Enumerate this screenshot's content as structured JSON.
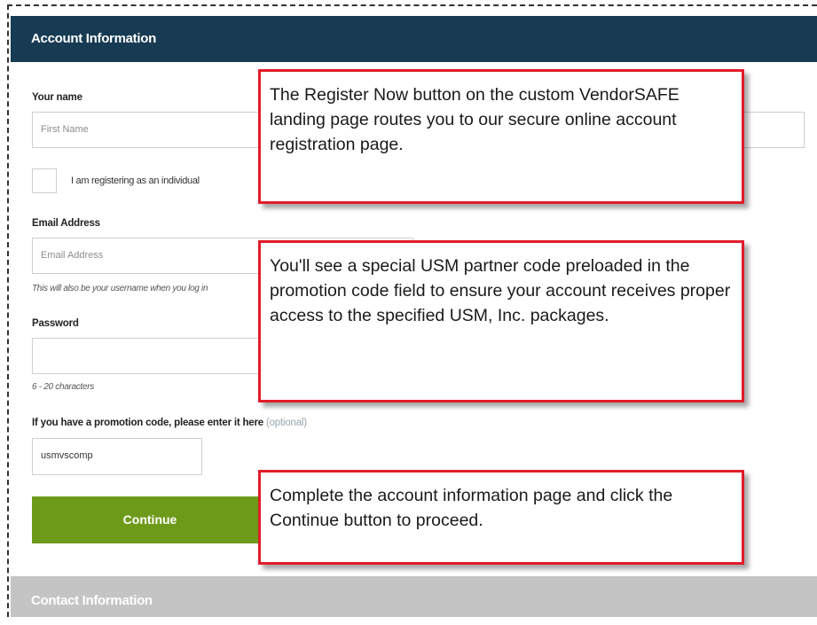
{
  "account_section": {
    "title": "Account Information"
  },
  "name": {
    "label": "Your name",
    "first_placeholder": "First Name",
    "last_placeholder": ""
  },
  "individual": {
    "label": "I am registering as an individual"
  },
  "email": {
    "label": "Email Address",
    "placeholder": "Email Address",
    "hint": "This will also be your username when you log in"
  },
  "password": {
    "label": "Password",
    "value": "",
    "hint": "6 - 20 characters"
  },
  "promo": {
    "label": "If you have a promotion code, please enter it here",
    "optional": "(optional)",
    "value": "usmvscomp"
  },
  "continue_button": {
    "label": "Continue"
  },
  "contact_section": {
    "title": "Contact Information"
  },
  "callouts": [
    {
      "text": "The Register Now button on the custom VendorSAFE landing page routes you to our secure online account registration page."
    },
    {
      "text": "You'll see a special USM partner code preloaded in the promotion code field to ensure your account receives proper access to the specified USM, Inc. packages."
    },
    {
      "text": "Complete the account information page and click the Continue button to proceed."
    }
  ],
  "colors": {
    "header": "#163b53",
    "continue": "#6e9a1a",
    "callout_border": "#e11c2a",
    "contact_header": "#c4c4c4"
  }
}
